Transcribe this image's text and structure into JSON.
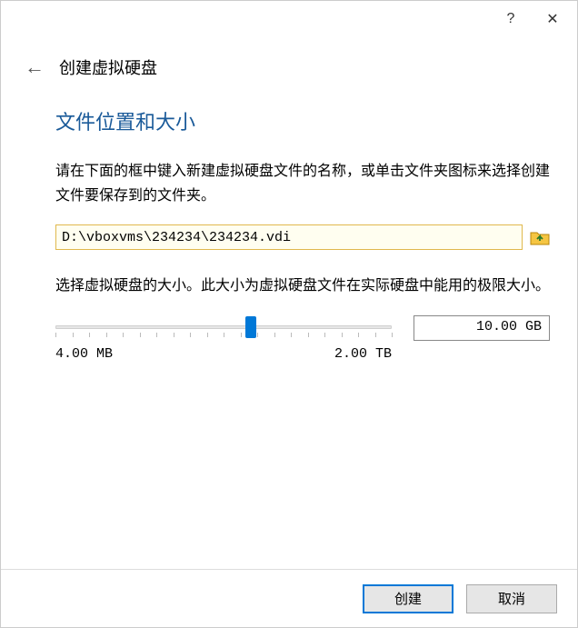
{
  "titlebar": {
    "help_glyph": "?",
    "close_glyph": "✕"
  },
  "header": {
    "back_glyph": "←",
    "wizard_title": "创建虚拟硬盘"
  },
  "section": {
    "title": "文件位置和大小",
    "desc1": "请在下面的框中键入新建虚拟硬盘文件的名称，或单击文件夹图标来选择创建文件要保存到的文件夹。",
    "path_value": "D:\\vboxvms\\234234\\234234.vdi",
    "desc2": "选择虚拟硬盘的大小。此大小为虚拟硬盘文件在实际硬盘中能用的极限大小。",
    "size_display": "10.00 GB",
    "range_min": "4.00 MB",
    "range_max": "2.00 TB",
    "slider_percent": 58
  },
  "footer": {
    "create_label": "创建",
    "cancel_label": "取消"
  }
}
